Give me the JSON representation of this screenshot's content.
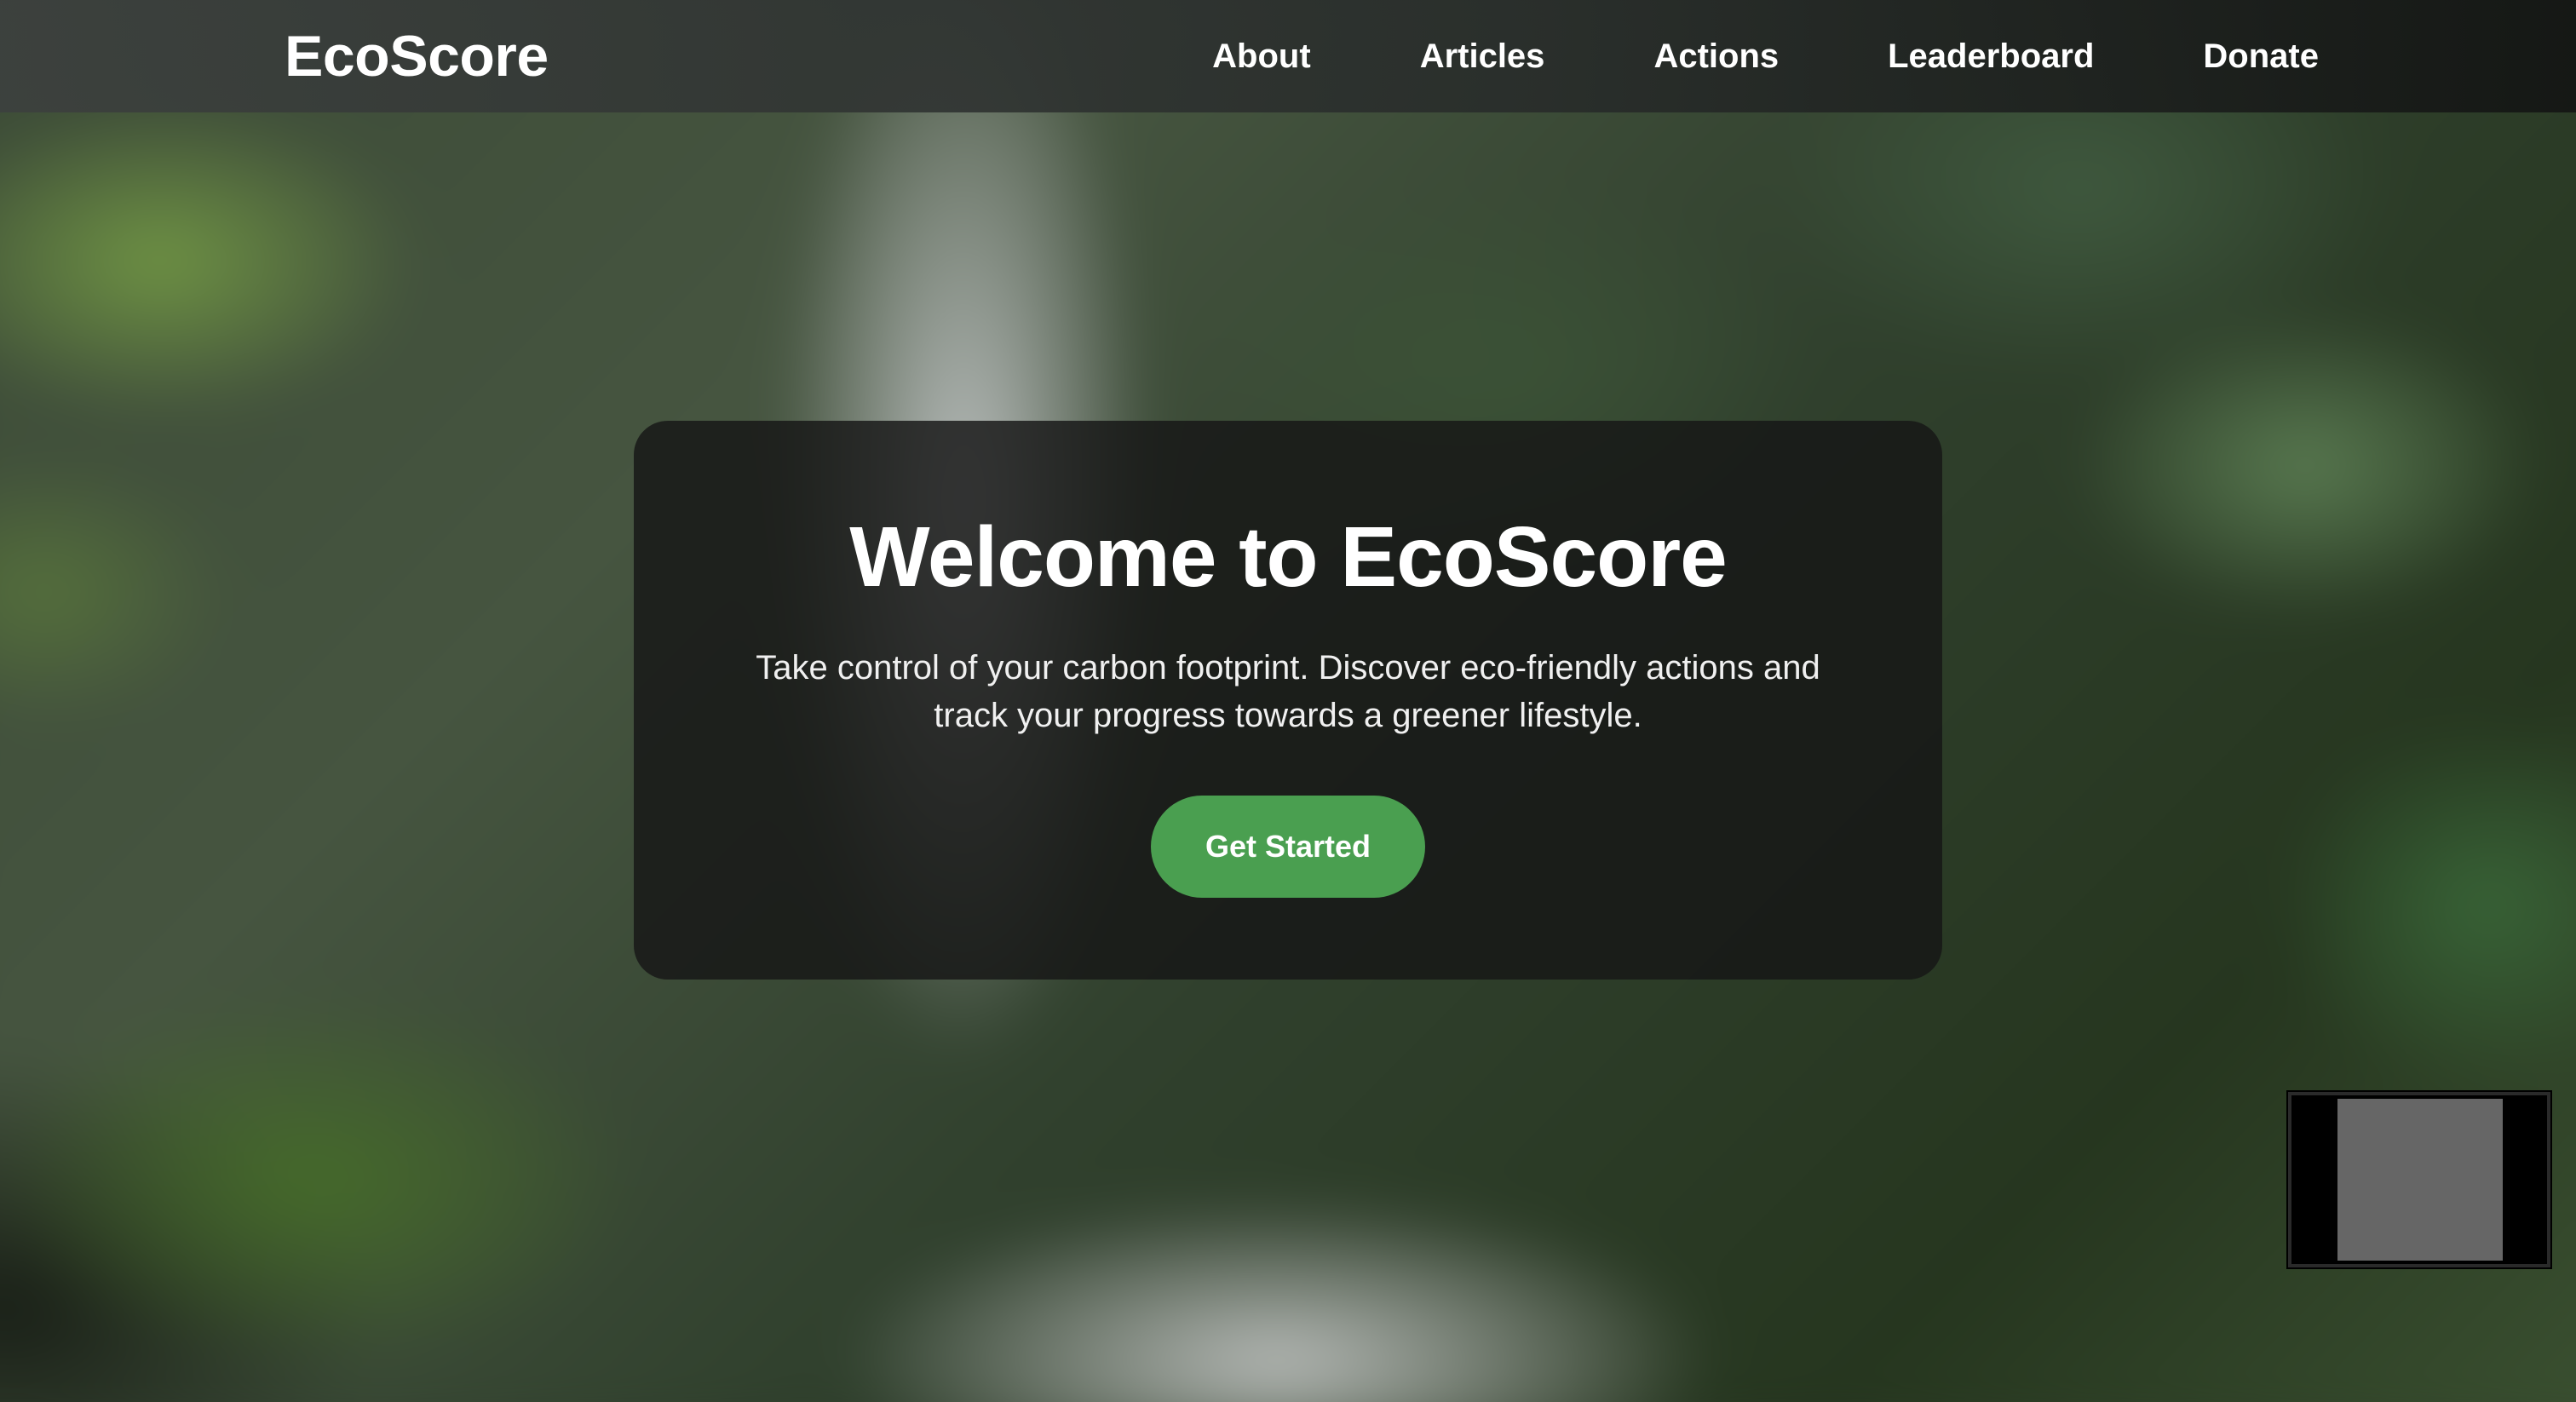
{
  "nav": {
    "brand": "EcoScore",
    "links": [
      "About",
      "Articles",
      "Actions",
      "Leaderboard",
      "Donate"
    ]
  },
  "hero": {
    "title": "Welcome to EcoScore",
    "subtitle": "Take control of your carbon footprint. Discover eco-friendly actions and track your progress towards a greener lifestyle.",
    "cta_label": "Get Started"
  },
  "colors": {
    "accent": "#4a9f50",
    "card_bg": "#161616",
    "text": "#ffffff"
  }
}
